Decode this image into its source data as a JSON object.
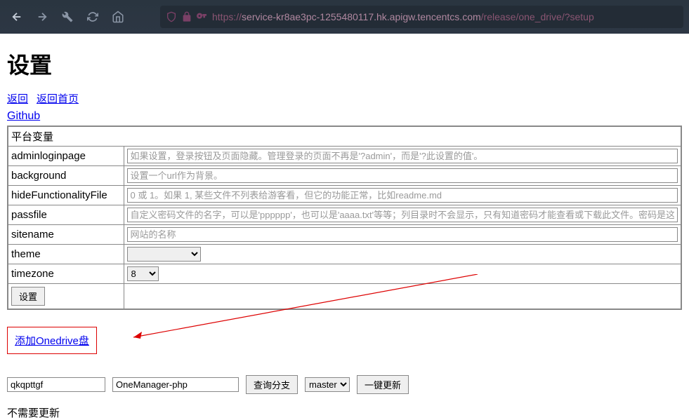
{
  "browser": {
    "url_prefix": "https://",
    "url_host": "service-kr8ae3pc-1255480117.hk.apigw.tencentcs.com",
    "url_path": "/release/one_drive/?setup"
  },
  "page": {
    "title": "设置",
    "back_link": "返回",
    "home_link": "返回首页",
    "github_link": "Github"
  },
  "table": {
    "header": "平台变量",
    "rows": {
      "adminloginpage": {
        "label": "adminloginpage",
        "placeholder": "如果设置，登录按钮及页面隐藏。管理登录的页面不再是'?admin'，而是'?此设置的值'。"
      },
      "background": {
        "label": "background",
        "placeholder": "设置一个url作为背景。"
      },
      "hideFunctionalityFile": {
        "label": "hideFunctionalityFile",
        "placeholder": "0 或 1。如果 1, 某些文件不列表给游客看，但它的功能正常，比如readme.md"
      },
      "passfile": {
        "label": "passfile",
        "placeholder": "自定义密码文件的名字，可以是'pppppp'，也可以是'aaaa.txt'等等；列目录时不会显示，只有知道密码才能查看或下载此文件。密码是这个"
      },
      "sitename": {
        "label": "sitename",
        "placeholder": "网站的名称"
      },
      "theme": {
        "label": "theme"
      },
      "timezone": {
        "label": "timezone",
        "selected": "8"
      }
    },
    "submit_label": "设置"
  },
  "add_drive": {
    "label": "添加Onedrive盘"
  },
  "update": {
    "owner": "qkqpttgf",
    "repo": "OneManager-php",
    "query_branch_label": "查询分支",
    "branch": "master",
    "update_label": "一键更新"
  },
  "status": "不需要更新"
}
